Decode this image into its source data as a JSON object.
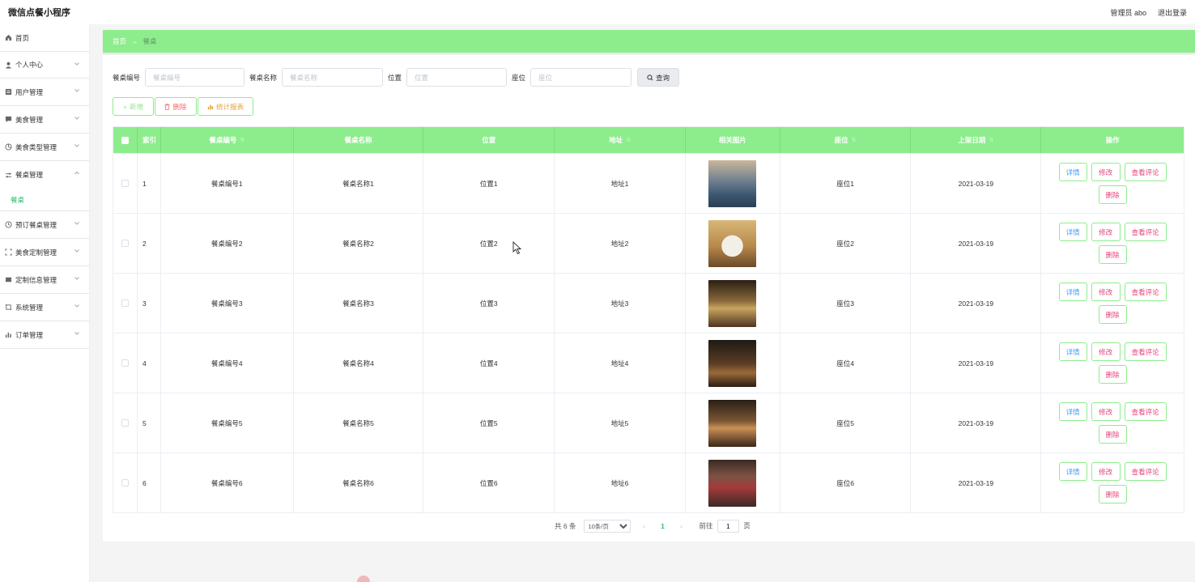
{
  "app": {
    "title": "微信点餐小程序"
  },
  "header": {
    "admin_label": "管理员 abo",
    "logout": "退出登录"
  },
  "sidebar": {
    "items": [
      {
        "label": "首页",
        "icon": "home-icon"
      },
      {
        "label": "个人中心",
        "icon": "user-icon"
      },
      {
        "label": "用户管理",
        "icon": "users-icon"
      },
      {
        "label": "美食管理",
        "icon": "chat-icon"
      },
      {
        "label": "美食类型管理",
        "icon": "chart-pie-icon"
      },
      {
        "label": "餐桌管理",
        "icon": "sliders-icon",
        "expanded": true
      },
      {
        "label": "预订餐桌管理",
        "icon": "clock-icon"
      },
      {
        "label": "美食定制管理",
        "icon": "crop-icon"
      },
      {
        "label": "定制信息管理",
        "icon": "ticket-icon"
      },
      {
        "label": "系统管理",
        "icon": "frame-icon"
      },
      {
        "label": "订单管理",
        "icon": "bar-chart-icon"
      }
    ],
    "sub_item": "餐桌"
  },
  "breadcrumb": {
    "home": "首页",
    "separator": "→",
    "current": "餐桌"
  },
  "search": {
    "no_label": "餐桌编号",
    "no_placeholder": "餐桌编号",
    "name_label": "餐桌名称",
    "name_placeholder": "餐桌名称",
    "pos_label": "位置",
    "pos_placeholder": "位置",
    "seat_label": "座位",
    "seat_placeholder": "座位",
    "query_button": "查询"
  },
  "actions": {
    "add": "新增",
    "delete": "删除",
    "stats": "统计报表"
  },
  "table": {
    "headers": {
      "index": "索引",
      "no": "餐桌编号",
      "name": "餐桌名称",
      "pos": "位置",
      "addr": "地址",
      "img": "相关图片",
      "seat": "座位",
      "date": "上架日期",
      "op": "操作"
    },
    "buttons": {
      "detail": "详情",
      "edit": "修改",
      "review": "查看评论",
      "remove": "删除"
    },
    "rows": [
      {
        "idx": "1",
        "no": "餐桌编号1",
        "name": "餐桌名称1",
        "pos": "位置1",
        "addr": "地址1",
        "seat": "座位1",
        "date": "2021-03-19"
      },
      {
        "idx": "2",
        "no": "餐桌编号2",
        "name": "餐桌名称2",
        "pos": "位置2",
        "addr": "地址2",
        "seat": "座位2",
        "date": "2021-03-19"
      },
      {
        "idx": "3",
        "no": "餐桌编号3",
        "name": "餐桌名称3",
        "pos": "位置3",
        "addr": "地址3",
        "seat": "座位3",
        "date": "2021-03-19"
      },
      {
        "idx": "4",
        "no": "餐桌编号4",
        "name": "餐桌名称4",
        "pos": "位置4",
        "addr": "地址4",
        "seat": "座位4",
        "date": "2021-03-19"
      },
      {
        "idx": "5",
        "no": "餐桌编号5",
        "name": "餐桌名称5",
        "pos": "位置5",
        "addr": "地址5",
        "seat": "座位5",
        "date": "2021-03-19"
      },
      {
        "idx": "6",
        "no": "餐桌编号6",
        "name": "餐桌名称6",
        "pos": "位置6",
        "addr": "地址6",
        "seat": "座位6",
        "date": "2021-03-19"
      }
    ]
  },
  "pagination": {
    "total": "共 6 条",
    "page_size": "10条/页",
    "current_page": "1",
    "goto_label": "前往",
    "goto_value": "1",
    "page_unit": "页"
  },
  "colors": {
    "accent": "#8ded8d",
    "active_text": "#2dbb70",
    "danger": "#f56c6c",
    "warning": "#e6a23c"
  }
}
